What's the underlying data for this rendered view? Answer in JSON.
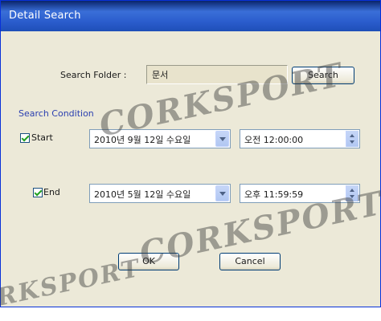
{
  "window": {
    "title": "Detail Search"
  },
  "search": {
    "folder_label": "Search Folder :",
    "folder_value": "문서",
    "search_button": "Search"
  },
  "condition": {
    "group_label": "Search Condition",
    "start": {
      "label": "Start",
      "checked": true,
      "date": "2010년 9월 12일 수요일",
      "time": "오전 12:00:00"
    },
    "end": {
      "label": "End",
      "checked": true,
      "date": "2010년 5월 12일 수요일",
      "time": "오후 11:59:59"
    }
  },
  "buttons": {
    "ok": "OK",
    "cancel": "Cancel"
  },
  "watermark": [
    "CORKSPORT",
    "CORKSPORT",
    "CORKSPORT"
  ]
}
